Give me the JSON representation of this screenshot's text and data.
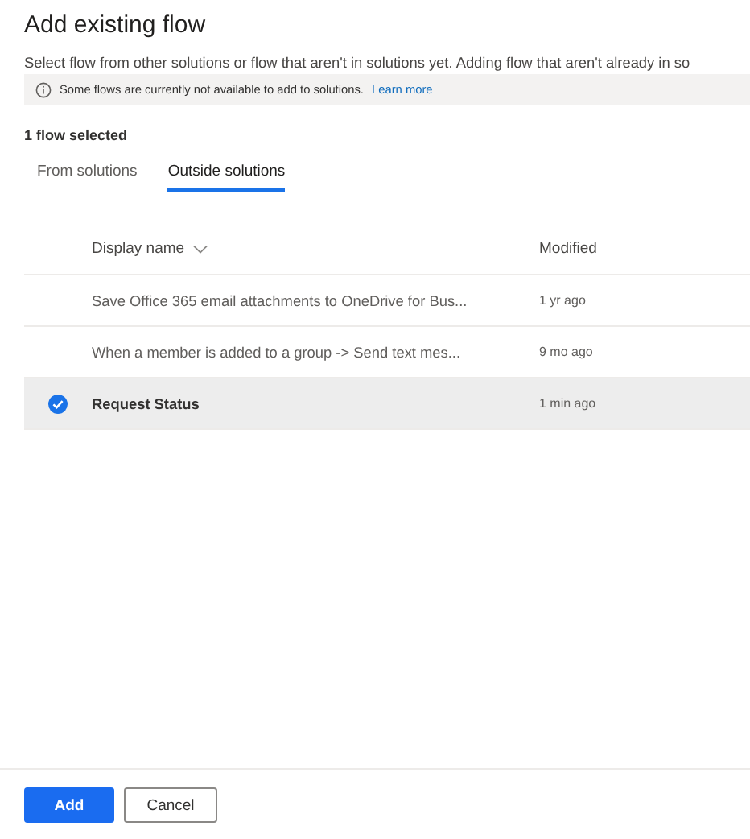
{
  "title": "Add existing flow",
  "description": "Select flow from other solutions or flow that aren't in solutions yet. Adding flow that aren't already in so",
  "info_bar": {
    "message": "Some flows are currently not available to add to solutions.",
    "link": "Learn more"
  },
  "selection_count": "1 flow selected",
  "tabs": [
    {
      "label": "From solutions",
      "selected": false
    },
    {
      "label": "Outside solutions",
      "selected": true
    }
  ],
  "table": {
    "columns": [
      "Display name",
      "Modified"
    ],
    "rows": [
      {
        "name": "Save Office 365 email attachments to OneDrive for Bus...",
        "modified": "1 yr ago",
        "selected": false
      },
      {
        "name": "When a member is added to a group -> Send text mes...",
        "modified": "9 mo ago",
        "selected": false
      },
      {
        "name": "Request Status",
        "modified": "1 min ago",
        "selected": true
      }
    ]
  },
  "buttons": [
    {
      "label": "Add",
      "kind": "primary"
    },
    {
      "label": "Cancel",
      "kind": "secondary"
    }
  ]
}
